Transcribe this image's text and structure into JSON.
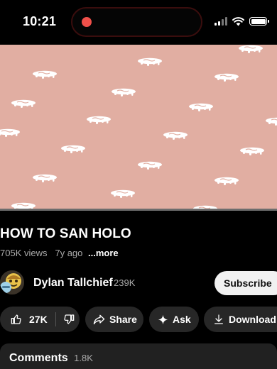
{
  "status_bar": {
    "time": "10:21",
    "recording_color": "#f0504a",
    "icons": [
      "cellular-signal-icon",
      "wifi-icon",
      "battery-icon"
    ]
  },
  "video": {
    "background_color": "#e1aea2",
    "progress_fraction": 0.0
  },
  "video_info": {
    "title": "HOW TO SAN HOLO",
    "views": "705K views",
    "age": "7y ago",
    "more_label": "...more"
  },
  "channel": {
    "name": "Dylan Tallchief",
    "subscribers": "239K",
    "subscribe_label": "Subscribe"
  },
  "actions": {
    "like_count": "27K",
    "share_label": "Share",
    "ask_label": "Ask",
    "download_label": "Download",
    "icons": [
      "thumbs-up-icon",
      "thumbs-down-icon",
      "share-icon",
      "sparkle-icon",
      "download-icon"
    ]
  },
  "comments": {
    "title": "Comments",
    "count": "1.8K"
  }
}
